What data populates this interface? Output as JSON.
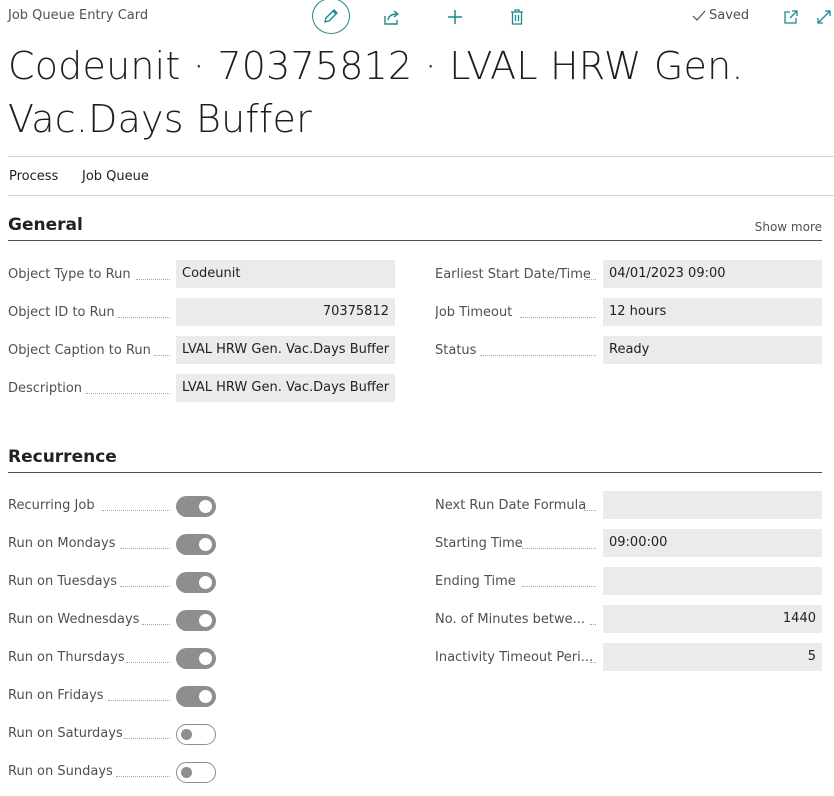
{
  "header": {
    "breadcrumb": "Job Queue Entry Card",
    "saved_label": "Saved",
    "title": "Codeunit · 70375812 · LVAL HRW Gen. Vac.Days Buffer"
  },
  "icons": {
    "edit": "pencil-icon",
    "share": "share-icon",
    "new": "plus-icon",
    "delete": "trash-icon",
    "open_new_window": "open-new-window-icon",
    "expand": "expand-icon",
    "saved_check": "check-icon"
  },
  "menu": {
    "process": "Process",
    "job_queue": "Job Queue"
  },
  "general": {
    "title": "General",
    "show_more": "Show more",
    "left": [
      {
        "label": "Object Type to Run",
        "value": "Codeunit",
        "align": "left"
      },
      {
        "label": "Object ID to Run",
        "value": "70375812",
        "align": "right"
      },
      {
        "label": "Object Caption to Run",
        "value": "LVAL HRW Gen. Vac.Days Buffer",
        "align": "left"
      },
      {
        "label": "Description",
        "value": "LVAL HRW Gen. Vac.Days Buffer",
        "align": "left"
      }
    ],
    "right": [
      {
        "label": "Earliest Start Date/Time",
        "value": "04/01/2023 09:00",
        "align": "left"
      },
      {
        "label": "Job Timeout",
        "value": "12 hours",
        "align": "left"
      },
      {
        "label": "Status",
        "value": "Ready",
        "align": "left"
      }
    ]
  },
  "recurrence": {
    "title": "Recurrence",
    "toggles": [
      {
        "label": "Recurring Job",
        "on": true
      },
      {
        "label": "Run on Mondays",
        "on": true
      },
      {
        "label": "Run on Tuesdays",
        "on": true
      },
      {
        "label": "Run on Wednesdays",
        "on": true
      },
      {
        "label": "Run on Thursdays",
        "on": true
      },
      {
        "label": "Run on Fridays",
        "on": true
      },
      {
        "label": "Run on Saturdays",
        "on": false
      },
      {
        "label": "Run on Sundays",
        "on": false
      }
    ],
    "right": [
      {
        "label": "Next Run Date Formula",
        "value": "",
        "align": "left"
      },
      {
        "label": "Starting Time",
        "value": "09:00:00",
        "align": "left"
      },
      {
        "label": "Ending Time",
        "value": "",
        "align": "left"
      },
      {
        "label": "No. of Minutes betwe...",
        "value": "1440",
        "align": "right"
      },
      {
        "label": "Inactivity Timeout Peri...",
        "value": "5",
        "align": "right"
      }
    ]
  },
  "colors": {
    "accent": "#1c8a8a",
    "field_bg": "#eaebec",
    "toggle_on": "#8d8e90"
  }
}
